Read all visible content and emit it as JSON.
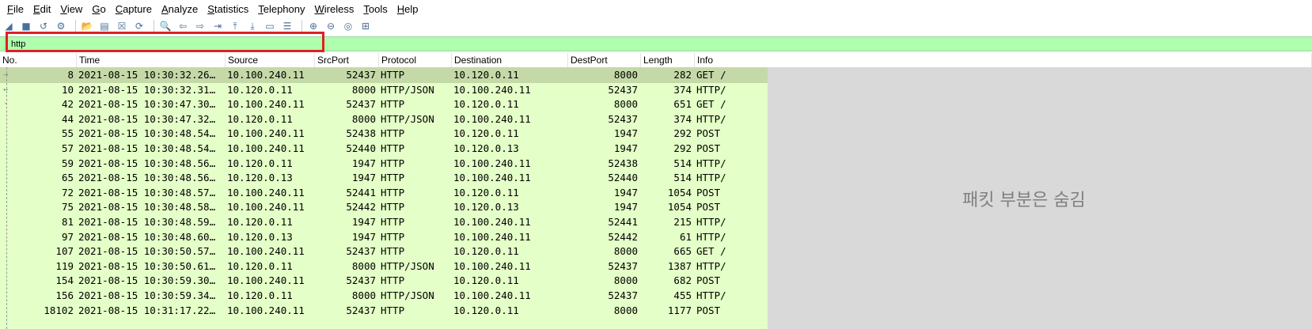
{
  "menu": [
    "File",
    "Edit",
    "View",
    "Go",
    "Capture",
    "Analyze",
    "Statistics",
    "Telephony",
    "Wireless",
    "Tools",
    "Help"
  ],
  "toolbar_icons": [
    "shark-fin-icon",
    "stop-icon",
    "restart-icon",
    "options-icon",
    "separator",
    "open-icon",
    "save-icon",
    "close-file-icon",
    "reload-icon",
    "separator",
    "find-icon",
    "back-icon",
    "forward-icon",
    "go-to-packet-icon",
    "first-packet-icon",
    "last-packet-icon",
    "autoscroll-icon",
    "colorize-icon",
    "separator",
    "zoom-in-icon",
    "zoom-out-icon",
    "normal-size-icon",
    "resize-columns-icon"
  ],
  "filter": {
    "value": "http"
  },
  "columns": [
    "No.",
    "Time",
    "Source",
    "SrcPort",
    "Protocol",
    "Destination",
    "DestPort",
    "Length",
    "Info"
  ],
  "packets": [
    {
      "no": "8",
      "time": "2021-08-15 10:30:32.26…",
      "src": "10.100.240.11",
      "sport": "52437",
      "proto": "HTTP",
      "dst": "10.120.0.11",
      "dport": "8000",
      "len": "282",
      "info": "GET /",
      "selected": true
    },
    {
      "no": "10",
      "time": "2021-08-15 10:30:32.31…",
      "src": "10.120.0.11",
      "sport": "8000",
      "proto": "HTTP/JSON",
      "dst": "10.100.240.11",
      "dport": "52437",
      "len": "374",
      "info": "HTTP/"
    },
    {
      "no": "42",
      "time": "2021-08-15 10:30:47.30…",
      "src": "10.100.240.11",
      "sport": "52437",
      "proto": "HTTP",
      "dst": "10.120.0.11",
      "dport": "8000",
      "len": "651",
      "info": "GET /"
    },
    {
      "no": "44",
      "time": "2021-08-15 10:30:47.32…",
      "src": "10.120.0.11",
      "sport": "8000",
      "proto": "HTTP/JSON",
      "dst": "10.100.240.11",
      "dport": "52437",
      "len": "374",
      "info": "HTTP/"
    },
    {
      "no": "55",
      "time": "2021-08-15 10:30:48.54…",
      "src": "10.100.240.11",
      "sport": "52438",
      "proto": "HTTP",
      "dst": "10.120.0.11",
      "dport": "1947",
      "len": "292",
      "info": "POST"
    },
    {
      "no": "57",
      "time": "2021-08-15 10:30:48.54…",
      "src": "10.100.240.11",
      "sport": "52440",
      "proto": "HTTP",
      "dst": "10.120.0.13",
      "dport": "1947",
      "len": "292",
      "info": "POST"
    },
    {
      "no": "59",
      "time": "2021-08-15 10:30:48.56…",
      "src": "10.120.0.11",
      "sport": "1947",
      "proto": "HTTP",
      "dst": "10.100.240.11",
      "dport": "52438",
      "len": "514",
      "info": "HTTP/"
    },
    {
      "no": "65",
      "time": "2021-08-15 10:30:48.56…",
      "src": "10.120.0.13",
      "sport": "1947",
      "proto": "HTTP",
      "dst": "10.100.240.11",
      "dport": "52440",
      "len": "514",
      "info": "HTTP/"
    },
    {
      "no": "72",
      "time": "2021-08-15 10:30:48.57…",
      "src": "10.100.240.11",
      "sport": "52441",
      "proto": "HTTP",
      "dst": "10.120.0.11",
      "dport": "1947",
      "len": "1054",
      "info": "POST"
    },
    {
      "no": "75",
      "time": "2021-08-15 10:30:48.58…",
      "src": "10.100.240.11",
      "sport": "52442",
      "proto": "HTTP",
      "dst": "10.120.0.13",
      "dport": "1947",
      "len": "1054",
      "info": "POST"
    },
    {
      "no": "81",
      "time": "2021-08-15 10:30:48.59…",
      "src": "10.120.0.11",
      "sport": "1947",
      "proto": "HTTP",
      "dst": "10.100.240.11",
      "dport": "52441",
      "len": "215",
      "info": "HTTP/"
    },
    {
      "no": "97",
      "time": "2021-08-15 10:30:48.60…",
      "src": "10.120.0.13",
      "sport": "1947",
      "proto": "HTTP",
      "dst": "10.100.240.11",
      "dport": "52442",
      "len": "61",
      "info": "HTTP/"
    },
    {
      "no": "107",
      "time": "2021-08-15 10:30:50.57…",
      "src": "10.100.240.11",
      "sport": "52437",
      "proto": "HTTP",
      "dst": "10.120.0.11",
      "dport": "8000",
      "len": "665",
      "info": "GET /"
    },
    {
      "no": "119",
      "time": "2021-08-15 10:30:50.61…",
      "src": "10.120.0.11",
      "sport": "8000",
      "proto": "HTTP/JSON",
      "dst": "10.100.240.11",
      "dport": "52437",
      "len": "1387",
      "info": "HTTP/"
    },
    {
      "no": "154",
      "time": "2021-08-15 10:30:59.30…",
      "src": "10.100.240.11",
      "sport": "52437",
      "proto": "HTTP",
      "dst": "10.120.0.11",
      "dport": "8000",
      "len": "682",
      "info": "POST"
    },
    {
      "no": "156",
      "time": "2021-08-15 10:30:59.34…",
      "src": "10.120.0.11",
      "sport": "8000",
      "proto": "HTTP/JSON",
      "dst": "10.100.240.11",
      "dport": "52437",
      "len": "455",
      "info": "HTTP/"
    },
    {
      "no": "18102",
      "time": "2021-08-15 10:31:17.22…",
      "src": "10.100.240.11",
      "sport": "52437",
      "proto": "HTTP",
      "dst": "10.120.0.11",
      "dport": "8000",
      "len": "1177",
      "info": "POST"
    }
  ],
  "hidden_pane_text": "패킷 부분은 숨김",
  "colors": {
    "filter_bg": "#afffaf",
    "row_bg": "#e4ffc7",
    "selected_row": "#c5d9a8",
    "highlight": "#e02020",
    "hidden_pane": "#d9d9d9"
  }
}
